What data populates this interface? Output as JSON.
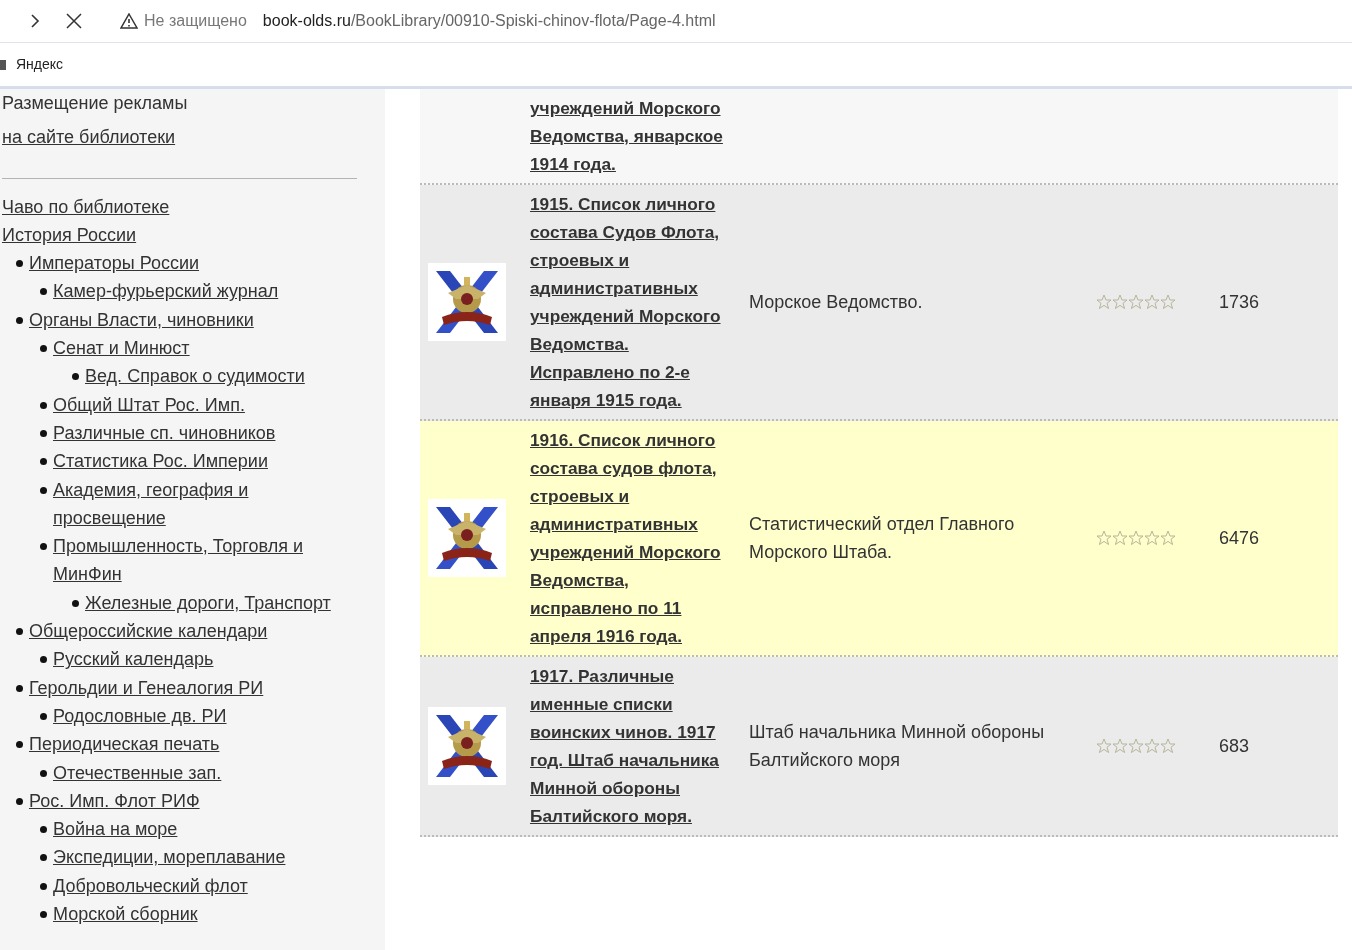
{
  "browser": {
    "security_label": "Не защищено",
    "url_host": "book-olds.ru",
    "url_path": "/BookLibrary/00910-Spiski-chinov-flota/Page-4.html"
  },
  "bookmarks": [
    {
      "label": "Яндекс"
    }
  ],
  "sidebar": {
    "ad_text": "Размещение рекламы",
    "ad_link": "на сайте библиотеки",
    "menu": [
      {
        "label": "Чаво по библиотеке"
      },
      {
        "label": "История России",
        "children": [
          {
            "label": "Императоры России",
            "children": [
              {
                "label": "Камер-фурьерский журнал"
              }
            ]
          },
          {
            "label": "Органы Власти, чиновники",
            "children": [
              {
                "label": "Сенат и Минюст",
                "children": [
                  {
                    "label": "Вед. Справок о судимости"
                  }
                ]
              },
              {
                "label": "Общий Штат Рос. Имп."
              },
              {
                "label": "Различные сп. чиновников"
              },
              {
                "label": "Статистика Рос. Империи"
              },
              {
                "label": "Академия, география и просвещение"
              },
              {
                "label": "Промышленность, Торговля и МинФин",
                "children": [
                  {
                    "label": "Железные дороги, Транспорт"
                  }
                ]
              }
            ]
          },
          {
            "label": "Общероссийские календари",
            "children": [
              {
                "label": "Русский календарь"
              }
            ]
          },
          {
            "label": "Герольдии и Генеалогия РИ",
            "children": [
              {
                "label": "Родословные дв. РИ"
              }
            ]
          },
          {
            "label": "Периодическая печать",
            "children": [
              {
                "label": "Отечественные зап."
              }
            ]
          },
          {
            "label": "Рос. Имп. Флот РИФ",
            "children": [
              {
                "label": "Война на море"
              },
              {
                "label": "Экспедиции, мореплавание"
              },
              {
                "label": "Добровольческий флот"
              },
              {
                "label": "Морской сборник"
              }
            ]
          }
        ]
      }
    ]
  },
  "books": [
    {
      "title": "учреждений Морского Ведомства, январское 1914 года.",
      "highlighted": false
    },
    {
      "title": "1915. Список личного состава Судов Флота, строевых и административных учреждений Морского Ведомства. Исправлено по 2-е января 1915 года.",
      "publisher": "Морское Ведомство.",
      "stars": 0,
      "count": "1736",
      "highlighted": false
    },
    {
      "title": "1916. Список личного состава судов флота, строевых и административных учреждений Морского Ведомства, исправлено по 11 апреля 1916 года.",
      "publisher": "Статистический отдел Главного Морского Штаба.",
      "stars": 0,
      "count": "6476",
      "highlighted": true
    },
    {
      "title": "1917. Различные именные списки воинских чинов. 1917 год. Штаб начальника Минной обороны Балтийского моря.",
      "publisher": "Штаб начальника Минной обороны Балтийского моря",
      "stars": 0,
      "count": "683",
      "highlighted": false
    }
  ]
}
